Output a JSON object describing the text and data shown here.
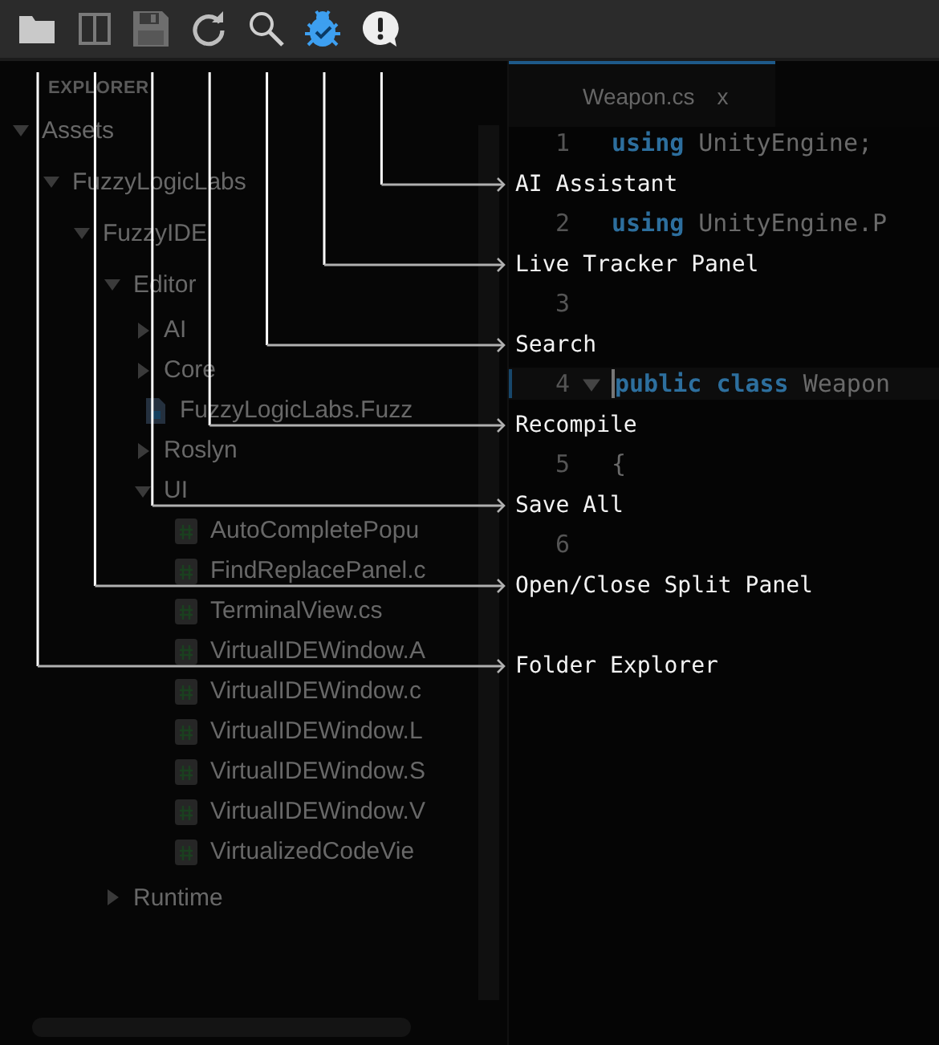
{
  "toolbar": {
    "icons": [
      {
        "kind": "folder"
      },
      {
        "kind": "split"
      },
      {
        "kind": "save"
      },
      {
        "kind": "recompile"
      },
      {
        "kind": "search"
      },
      {
        "kind": "bug"
      },
      {
        "kind": "alert"
      }
    ]
  },
  "callouts": [
    {
      "label": "AI Assistant"
    },
    {
      "label": "Live Tracker Panel"
    },
    {
      "label": "Search"
    },
    {
      "label": "Recompile"
    },
    {
      "label": "Save All"
    },
    {
      "label": "Open/Close Split Panel"
    },
    {
      "label": "Folder Explorer"
    }
  ],
  "explorer": {
    "title": "EXPLORER",
    "tree": [
      {
        "label": "Assets",
        "kind": "folder",
        "expanded": true,
        "children": [
          {
            "label": "FuzzyLogicLabs",
            "kind": "folder",
            "expanded": true,
            "children": [
              {
                "label": "FuzzyIDE",
                "kind": "folder",
                "expanded": true,
                "children": [
                  {
                    "label": "Editor",
                    "kind": "folder",
                    "expanded": true,
                    "children": [
                      {
                        "label": "AI",
                        "kind": "folder",
                        "expanded": false
                      },
                      {
                        "label": "Core",
                        "kind": "folder",
                        "expanded": false
                      },
                      {
                        "label": "FuzzyLogicLabs.Fuzz",
                        "kind": "asmdef"
                      },
                      {
                        "label": "Roslyn",
                        "kind": "folder",
                        "expanded": false
                      },
                      {
                        "label": "UI",
                        "kind": "folder",
                        "expanded": true,
                        "children": [
                          {
                            "label": "AutoCompletePopu",
                            "kind": "script"
                          },
                          {
                            "label": "FindReplacePanel.c",
                            "kind": "script"
                          },
                          {
                            "label": "TerminalView.cs",
                            "kind": "script"
                          },
                          {
                            "label": "VirtualIDEWindow.A",
                            "kind": "script"
                          },
                          {
                            "label": "VirtualIDEWindow.c",
                            "kind": "script"
                          },
                          {
                            "label": "VirtualIDEWindow.L",
                            "kind": "script"
                          },
                          {
                            "label": "VirtualIDEWindow.S",
                            "kind": "script"
                          },
                          {
                            "label": "VirtualIDEWindow.V",
                            "kind": "script"
                          },
                          {
                            "label": "VirtualizedCodeVie",
                            "kind": "script"
                          }
                        ]
                      }
                    ]
                  },
                  {
                    "label": "Runtime",
                    "kind": "folder",
                    "expanded": false
                  }
                ]
              }
            ]
          }
        ]
      }
    ]
  },
  "editor": {
    "tabs": [
      {
        "label": "Weapon.cs",
        "close": "x",
        "selected": true
      }
    ],
    "lines": [
      {
        "number": "1",
        "current": false,
        "foldable": false,
        "tokens": [
          {
            "kind": "keyword",
            "text": "using"
          },
          {
            "kind": "plain",
            "text": "UnityEngine;"
          }
        ]
      },
      {
        "number": "2",
        "current": false,
        "foldable": false,
        "tokens": [
          {
            "kind": "keyword",
            "text": "using"
          },
          {
            "kind": "plain",
            "text": "UnityEngine.P"
          }
        ]
      },
      {
        "number": "3",
        "current": false,
        "foldable": false
      },
      {
        "number": "4",
        "current": true,
        "foldable": true,
        "tokens": [
          {
            "kind": "keyword",
            "text": "public"
          },
          {
            "kind": "keyword",
            "text": "class"
          },
          {
            "kind": "plain",
            "text": "Weapon"
          }
        ]
      },
      {
        "number": "5",
        "current": false,
        "foldable": false,
        "tokens": [
          {
            "kind": "plain",
            "text": "{"
          }
        ]
      },
      {
        "number": "6",
        "current": false,
        "foldable": false
      }
    ]
  }
}
